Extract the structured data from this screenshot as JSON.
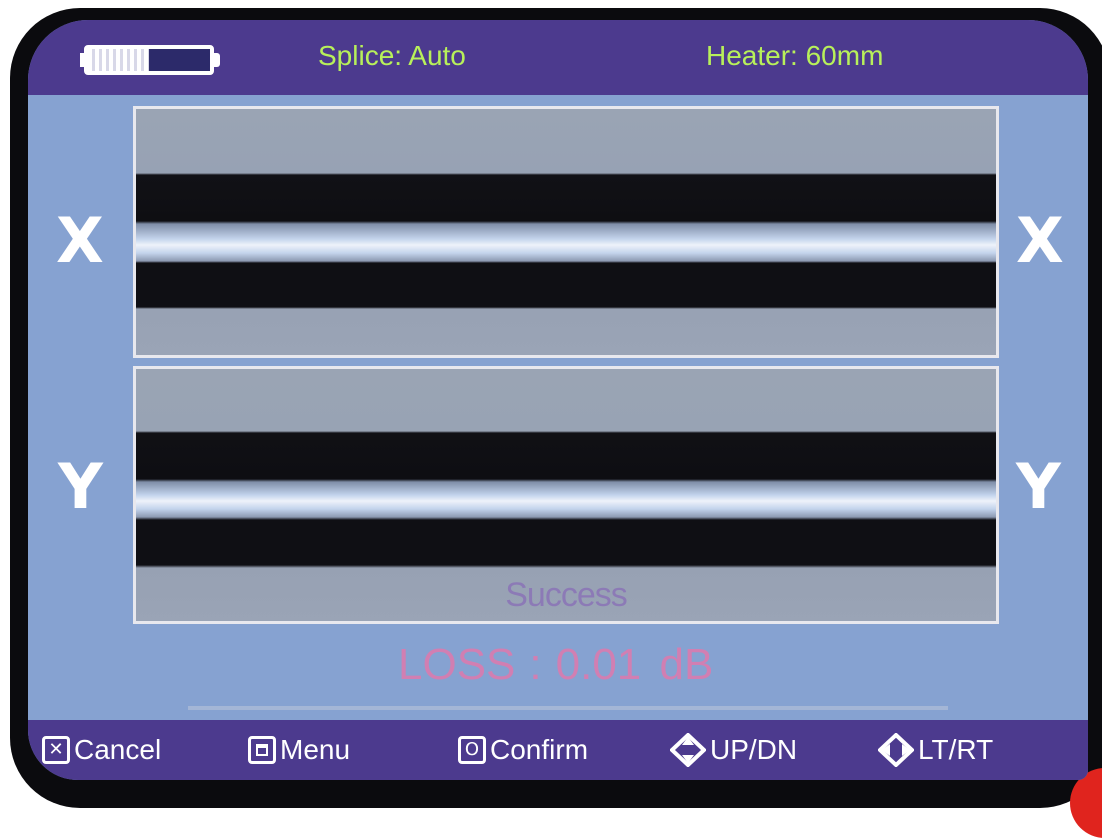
{
  "status_bar": {
    "battery": {
      "level": 0.5
    },
    "splice_mode": "Splice: Auto",
    "heater": "Heater: 60mm"
  },
  "views": {
    "x_label": "X",
    "y_label": "Y"
  },
  "result": {
    "status": "Success",
    "loss_label": "LOSS",
    "loss_separator": ":",
    "loss_value": "0.01",
    "loss_unit": "dB"
  },
  "softkeys": [
    {
      "label": "Cancel",
      "icon": "cancel-key-icon"
    },
    {
      "label": "Menu",
      "icon": "menu-key-icon"
    },
    {
      "label": "Confirm",
      "icon": "confirm-key-icon"
    },
    {
      "label": "UP/DN",
      "icon": "up-down-arrows-icon"
    },
    {
      "label": "LT/RT",
      "icon": "left-right-arrows-icon"
    }
  ],
  "colors": {
    "status_bar_bg": "#4c3a8e",
    "status_text": "#b8f05a",
    "screen_bg": "#86a2d1",
    "success_text": "#8c7ab6",
    "loss_text": "#d17fb2"
  }
}
